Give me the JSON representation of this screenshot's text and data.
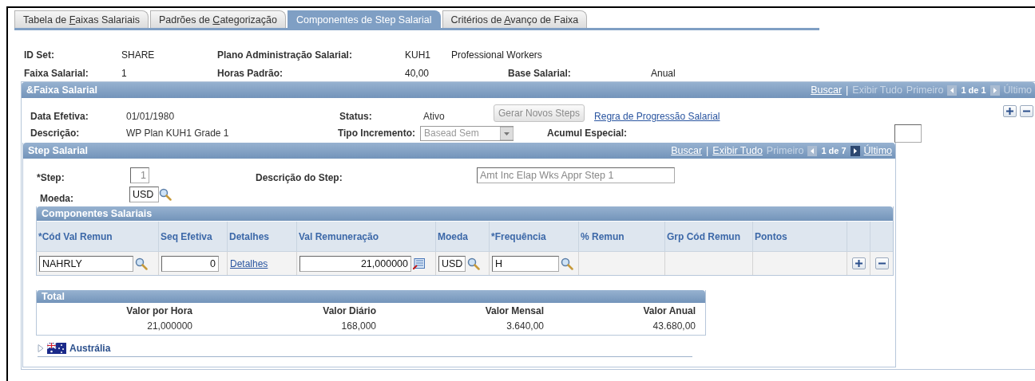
{
  "tabs": [
    {
      "label_start": "Tabela de ",
      "access_key": "F",
      "label_end": "aixas Salariais",
      "selected": false
    },
    {
      "label_start": "Padrões de ",
      "access_key": "C",
      "label_end": "ategorização",
      "selected": false
    },
    {
      "label_start": "Componentes de Step Salarial",
      "selected": true
    },
    {
      "label_start": "Critérios de ",
      "access_key": "A",
      "label_end": "vanço de Faixa",
      "selected": false
    }
  ],
  "header": [
    [
      {
        "kind": "label",
        "text": "ID Set:"
      },
      {
        "kind": "value",
        "text": "SHARE"
      },
      {
        "kind": "label",
        "text": "Plano Administração Salarial:"
      },
      {
        "kind": "value",
        "text": "KUH1"
      },
      {
        "kind": "value",
        "text": "Professional Workers"
      }
    ],
    [
      {
        "kind": "label",
        "text": "Faixa Salarial:"
      },
      {
        "kind": "value",
        "text": "1"
      },
      {
        "kind": "label",
        "text": "Horas Padrão:"
      },
      {
        "kind": "value",
        "text": "40,00"
      },
      {
        "kind": "label",
        "text": "Base Salarial:"
      },
      {
        "kind": "value",
        "text": "Anual"
      }
    ]
  ],
  "faixa_panel": {
    "title": "&Faixa Salarial",
    "nav": [
      {
        "kind": "link",
        "text": "Buscar"
      },
      {
        "kind": "sep",
        "text": "|"
      },
      {
        "kind": "text",
        "text": "Exibir Tudo",
        "disabled": true
      },
      {
        "kind": "text",
        "text": "Primeiro",
        "disabled": true
      },
      {
        "kind": "prev",
        "disabled": true
      },
      {
        "kind": "count",
        "text": "1 de 1"
      },
      {
        "kind": "next",
        "disabled": true
      },
      {
        "kind": "text",
        "text": "Último",
        "disabled": true
      }
    ],
    "data_efetiva": {
      "label": "Data Efetiva:",
      "value": "01/01/1980"
    },
    "status": {
      "label": "Status:",
      "value": "Ativo"
    },
    "generate_button": {
      "label": "Gerar Novos Steps",
      "disabled": true
    },
    "rule_link": "Regra de Progressão Salarial",
    "descricao": {
      "label": "Descrição:",
      "value": "WP Plan KUH1 Grade 1"
    },
    "tipo_incremento": {
      "label": "Tipo Incremento:",
      "value": "Basead Sem",
      "disabled": true
    },
    "acumul_especial": {
      "label": "Acumul Especial:"
    }
  },
  "step_panel": {
    "title": "Step Salarial",
    "nav": [
      {
        "kind": "link",
        "text": "Buscar"
      },
      {
        "kind": "sep",
        "text": "|"
      },
      {
        "kind": "link",
        "text": "Exibir Tudo"
      },
      {
        "kind": "text",
        "text": "Primeiro",
        "disabled": true
      },
      {
        "kind": "prev",
        "disabled": true
      },
      {
        "kind": "count",
        "text": "1 de 7"
      },
      {
        "kind": "next",
        "disabled": false
      },
      {
        "kind": "link",
        "text": "Último"
      }
    ],
    "step": {
      "label": "*Step:",
      "value": "1",
      "disabled": true
    },
    "step_description": {
      "label": "Descrição do Step:",
      "value": "Amt Inc Elap Wks Appr Step 1",
      "disabled": true
    },
    "moeda": {
      "label": "Moeda:",
      "value": "USD"
    }
  },
  "components": {
    "title": "Componentes Salariais",
    "columns": [
      "*Cód Val Remun",
      "Seq Efetiva",
      "Detalhes",
      "Val Remuneração",
      "Moeda",
      "*Frequência",
      "% Remun",
      "Grp Cód Remun",
      "Pontos"
    ],
    "rows": [
      [
        {
          "kind": "lookup",
          "value": "NAHRLY"
        },
        {
          "kind": "number",
          "value": "0"
        },
        {
          "kind": "link",
          "value": "Detalhes"
        },
        {
          "kind": "amount",
          "value": "21,000000"
        },
        {
          "kind": "lookup",
          "value": "USD"
        },
        {
          "kind": "lookup",
          "value": "H"
        },
        {
          "kind": "empty"
        },
        {
          "kind": "empty"
        },
        {
          "kind": "empty"
        },
        {
          "kind": "add"
        },
        {
          "kind": "remove"
        }
      ]
    ]
  },
  "total": {
    "title": "Total",
    "columns": [
      "Valor por Hora",
      "Valor Diário",
      "Valor Mensal",
      "Valor Anual"
    ],
    "values": [
      "21,000000",
      "168,000",
      "3.640,00",
      "43.680,00"
    ]
  },
  "country": {
    "name": "Austrália",
    "expanded": false
  }
}
